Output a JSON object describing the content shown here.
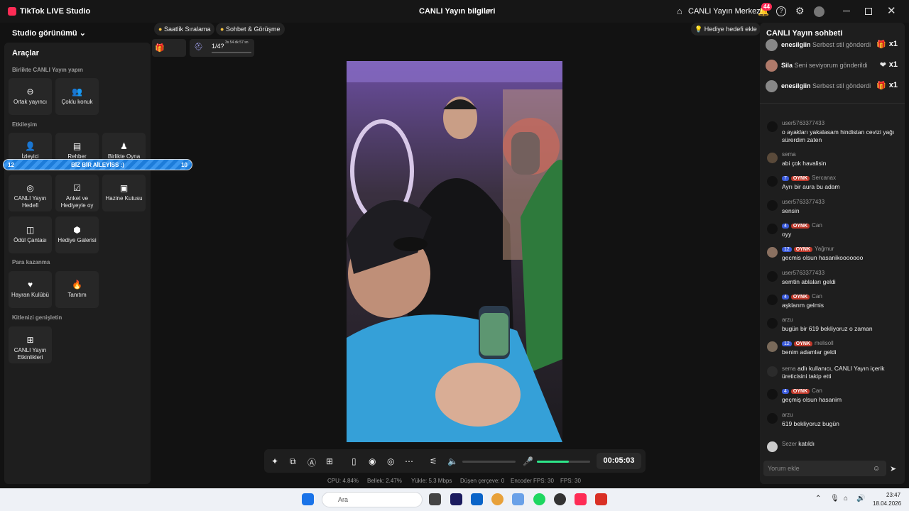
{
  "titlebar": {
    "app_name": "TikTok LIVE Studio",
    "center_title": "CANLI Yayın bilgileri",
    "live_center": "CANLI Yayın Merkezi",
    "notif_count": "44"
  },
  "left": {
    "studio_view": "Studio görünümü",
    "tools_title": "Araçlar",
    "sections": [
      "Birlikte CANLI Yayın yapın",
      "Etkileşim",
      "Para kazanma",
      "Kitlenizi genişletin"
    ],
    "tools": {
      "co_host": "Ortak yayıncı",
      "multi_guest": "Çoklu konuk",
      "viewer": "İzleyici",
      "guide": "Rehber",
      "play_together": "Birlikte Oyna",
      "live_goal": "CANLI Yayın Hedefi",
      "poll": "Anket ve Hediyeyle oy",
      "treasure": "Hazine Kutusu",
      "reward_bag": "Ödül Çantası",
      "gift_gallery": "Hediye Galerisi",
      "fan_club": "Hayran Kulübü",
      "promote": "Tanıtım",
      "live_events": "CANLI Yayın Etkinlikleri"
    }
  },
  "pk": {
    "left_value": "12",
    "text": "BİZ BİR AİLEYİSS :)",
    "right_value": "10"
  },
  "top": {
    "hourly_rank": "Saatlik Sıralama",
    "chat_meet": "Sohbet & Görüşme",
    "add_gift_goal": "Hediye hedefi ekle",
    "goal_progress": "1/4?",
    "goal_time": "3s 54 dk 57 sn"
  },
  "controls": {
    "timer": "00:05:03",
    "mic_level": 0.6
  },
  "stats": {
    "cpu": "CPU:  4.84%",
    "memory": "Bellek:  2.47%",
    "upload": "Yükle:  5.3 Mbps",
    "dropped": "Düşen çerçeve:  0",
    "encoder_fps": "Encoder FPS:  30",
    "fps": "FPS:  30"
  },
  "chat": {
    "title": "CANLI Yayın sohbeti",
    "gifts": [
      {
        "user": "enesilgiin",
        "action": "Serbest stil gönderdi",
        "count": "x1"
      },
      {
        "user": "Sila",
        "action": "Seni seviyorum gönderildi",
        "count": "x1"
      },
      {
        "user": "enesilgiin",
        "action": "Serbest stil gönderdi",
        "count": "x1"
      }
    ],
    "messages": [
      {
        "user": "user5763377433",
        "text": "o ayakları yakalasam hindistan cevizi yağı sürerdim zaten"
      },
      {
        "user": "sema",
        "text": "abi çok havalisin"
      },
      {
        "level": "7",
        "badge": "OYNK",
        "user": "Sercanax",
        "text": "Ayrı bir aura bu adam"
      },
      {
        "user": "user5763377433",
        "text": "sensin"
      },
      {
        "level": "4",
        "badge": "OYNK",
        "user": "Can",
        "text": "oyy"
      },
      {
        "level": "12",
        "badge": "OYNK",
        "user": "Yağmur",
        "text": "gecmis olsun hasanikooooooo"
      },
      {
        "user": "user5763377433",
        "text": "semtin ablaları geldi"
      },
      {
        "level": "4",
        "badge": "OYNK",
        "user": "Can",
        "text": "aşklarım gelmis"
      },
      {
        "user": "arzu",
        "text": "bugün bir 619 bekliyoruz o zaman"
      },
      {
        "level": "12",
        "badge": "OYNK",
        "user": "melisoll",
        "text": "benim adamlar geldi"
      },
      {
        "level": "4",
        "badge": "OYNK",
        "user": "Can",
        "text": "geçmiş olsun hasanim"
      },
      {
        "user": "arzu",
        "text": "619 bekliyoruz bugün"
      }
    ],
    "follow": {
      "user": "sema",
      "text": "adlı kullanıcı, CANLI Yayın içerik üreticisini takip etti"
    },
    "joined": {
      "user": "Sezer",
      "text": "katıldı"
    },
    "input_placeholder": "Yorum ekle"
  },
  "taskbar": {
    "search": "Ara",
    "time": "23:47",
    "date": "18.04.2026"
  }
}
